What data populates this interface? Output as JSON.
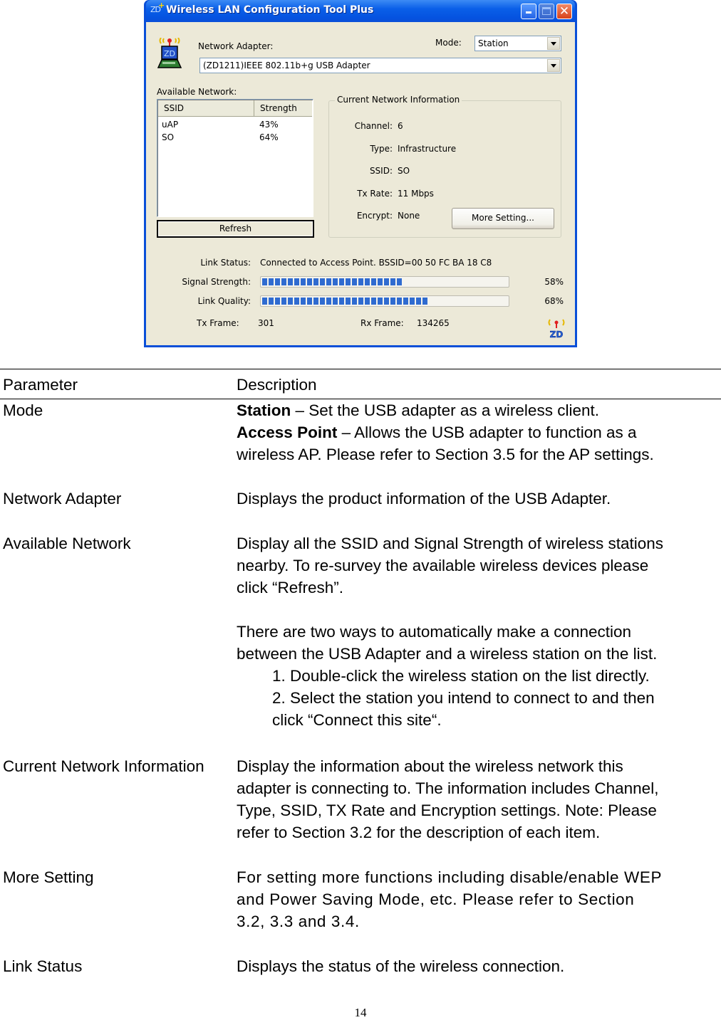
{
  "window": {
    "title": "Wireless LAN Configuration Tool Plus",
    "title_icon": "zd-logo-icon",
    "controls": [
      "minimize",
      "maximize",
      "close"
    ]
  },
  "adapter": {
    "label": "Network Adapter:",
    "value": "(ZD1211)IEEE 802.11b+g USB Adapter",
    "icon": "zd-laptop-antenna-icon"
  },
  "mode": {
    "label": "Mode:",
    "value": "Station"
  },
  "available_network": {
    "label": "Available Network:",
    "columns": [
      "SSID",
      "Strength"
    ],
    "rows": [
      {
        "ssid": "uAP",
        "strength": "43%"
      },
      {
        "ssid": "SO",
        "strength": "64%"
      }
    ],
    "refresh_label": "Refresh"
  },
  "current_info": {
    "legend": "Current Network Information",
    "fields": [
      {
        "label": "Channel:",
        "value": "6"
      },
      {
        "label": "Type:",
        "value": "Infrastructure"
      },
      {
        "label": "SSID:",
        "value": "SO"
      },
      {
        "label": "Tx Rate:",
        "value": "11 Mbps"
      },
      {
        "label": "Encrypt:",
        "value": "None"
      }
    ],
    "more_setting_label": "More Setting..."
  },
  "status": {
    "link_status_label": "Link Status:",
    "link_status_value": "Connected to Access Point. BSSID=00 50 FC BA 18 C8",
    "signal_label": "Signal Strength:",
    "signal_percent": 58,
    "signal_text": "58%",
    "quality_label": "Link Quality:",
    "quality_percent": 68,
    "quality_text": "68%",
    "tx_label": "Tx Frame:",
    "tx_value": "301",
    "rx_label": "Rx Frame:",
    "rx_value": "134265"
  },
  "colors": {
    "titlebar": "#0a5fe8",
    "client_bg": "#ece9d8",
    "progress_fill": "#2f6bd0"
  },
  "doc": {
    "header": {
      "parameter": "Parameter",
      "description": "Description"
    },
    "mode": {
      "param": "Mode",
      "station_bold": "Station",
      "station_text": " – Set the USB adapter as a wireless client.",
      "ap_bold": "Access Point",
      "ap_text": " – Allows the USB adapter to function as a",
      "ap_line2": "wireless AP. Please refer to Section 3.5 for the AP settings."
    },
    "network_adapter": {
      "param": "Network Adapter",
      "desc": "Displays the product information of the USB Adapter."
    },
    "available_network": {
      "param": "Available Network",
      "lines": [
        "Display all the SSID and Signal Strength of wireless stations",
        "nearby. To re-survey the available wireless devices please",
        "click “Refresh”."
      ],
      "lines2": [
        "There are two ways to automatically make a connection",
        "between the USB Adapter and a wireless station on the list."
      ],
      "steps": [
        "1. Double-click the wireless station on the list directly.",
        "2. Select the station you intend to connect to and then",
        "click “Connect this site“."
      ]
    },
    "current_network": {
      "param": "Current Network Information",
      "lines": [
        "Display the information about the wireless network this",
        "adapter is connecting to. The information includes Channel,",
        "Type, SSID, TX Rate and Encryption settings. Note: Please",
        "refer to Section 3.2 for the description of each item."
      ]
    },
    "more_setting": {
      "param": "More Setting",
      "lines": [
        "For setting more functions including disable/enable WEP",
        "and Power Saving Mode, etc. Please refer to Section",
        "3.2, 3.3 and 3.4."
      ]
    },
    "link_status": {
      "param": "Link Status",
      "desc": "Displays the status of the wireless connection."
    },
    "page_number": "14"
  }
}
